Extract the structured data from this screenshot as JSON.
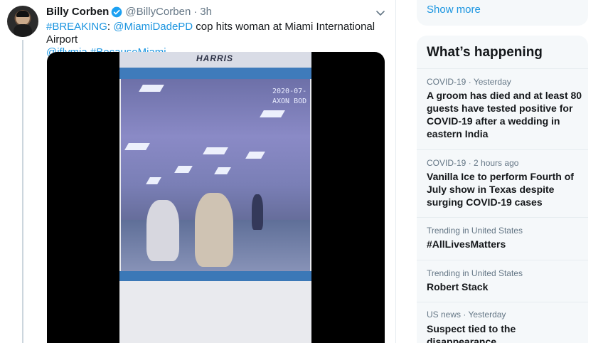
{
  "tweet": {
    "author_name": "Billy Corben",
    "handle": "@BillyCorben",
    "separator": "·",
    "time": "3h",
    "text": {
      "breaking": "#BREAKING",
      "colon": ":",
      "mention": "@MiamiDadePD",
      "body": " cop hits woman at Miami International Airport",
      "mention2": "@iflymia",
      "hashtag2": "#BecauseMiami"
    },
    "video": {
      "sign": "HARRIS",
      "stamp_line1": "2020-07-",
      "stamp_line2": "AXON BOD"
    }
  },
  "sidebar": {
    "show_more": "Show more",
    "heading": "What’s happening",
    "trends": [
      {
        "category": "COVID-19",
        "time": "Yesterday",
        "title": "A groom has died and at least 80 guests have tested positive for COVID-19 after a wedding in eastern India"
      },
      {
        "category": "COVID-19",
        "time": "2 hours ago",
        "title": "Vanilla Ice to perform Fourth of July show in Texas despite surging COVID-19 cases"
      },
      {
        "category": "Trending in United States",
        "time": "",
        "title": "#AllLivesMatters"
      },
      {
        "category": "Trending in United States",
        "time": "",
        "title": "Robert Stack"
      },
      {
        "category": "US news",
        "time": "Yesterday",
        "title": "Suspect tied to the disappearance"
      }
    ]
  },
  "colors": {
    "link": "#1b95e0",
    "secondary_text": "#657786",
    "border": "#e6ecf0",
    "panel_bg": "#f5f8fa"
  }
}
